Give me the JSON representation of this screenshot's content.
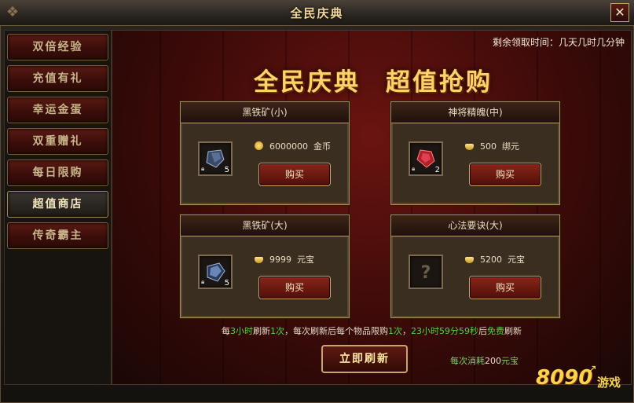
{
  "window": {
    "title": "全民庆典",
    "close_label": "✕"
  },
  "sidebar": {
    "items": [
      {
        "label": "双倍经验"
      },
      {
        "label": "充值有礼"
      },
      {
        "label": "幸运金蛋"
      },
      {
        "label": "双重赠礼"
      },
      {
        "label": "每日限购"
      },
      {
        "label": "超值商店",
        "active": true
      },
      {
        "label": "传奇霸主"
      }
    ]
  },
  "main": {
    "countdown": "剩余领取时间：几天几时几分钟",
    "banner_left": "全民庆典",
    "banner_right": "超值抢购",
    "cards": [
      {
        "title": "黑铁矿(小)",
        "price": "6000000",
        "currency": "金币",
        "count": "5",
        "buy_label": "购买",
        "item_icon": "black-iron-ore-icon",
        "price_icon": "gold-coin-icon"
      },
      {
        "title": "神将精魄(中)",
        "price": "500",
        "currency": "绑元",
        "count": "2",
        "buy_label": "购买",
        "item_icon": "red-spirit-gem-icon",
        "price_icon": "bound-ingot-icon"
      },
      {
        "title": "黑铁矿(大)",
        "price": "9999",
        "currency": "元宝",
        "count": "5",
        "buy_label": "购买",
        "item_icon": "black-iron-ore-large-icon",
        "price_icon": "ingot-icon"
      },
      {
        "title": "心法要诀(大)",
        "price": "5200",
        "currency": "元宝",
        "count": "",
        "buy_label": "购买",
        "item_icon": "unknown-item-icon",
        "price_icon": "ingot-icon"
      }
    ],
    "info": {
      "p1": "每",
      "h1": "3小时",
      "p2": "刷新",
      "h2": "1次",
      "p3": "，每次刷新后每个物品限购",
      "h3": "1次",
      "p4": "，",
      "h4": "23小时59分59秒",
      "p5": "后",
      "h5": "免费",
      "p6": "刷新"
    },
    "refresh_label": "立即刷新",
    "cost": {
      "p1": "每次消耗",
      "amount": "200",
      "p2": "元宝"
    }
  },
  "watermark": {
    "number": "8090",
    "text": "游戏"
  },
  "colors": {
    "accent_gold": "#ffd36a",
    "highlight_green": "#48d83c",
    "bg_red": "#6a1410"
  }
}
